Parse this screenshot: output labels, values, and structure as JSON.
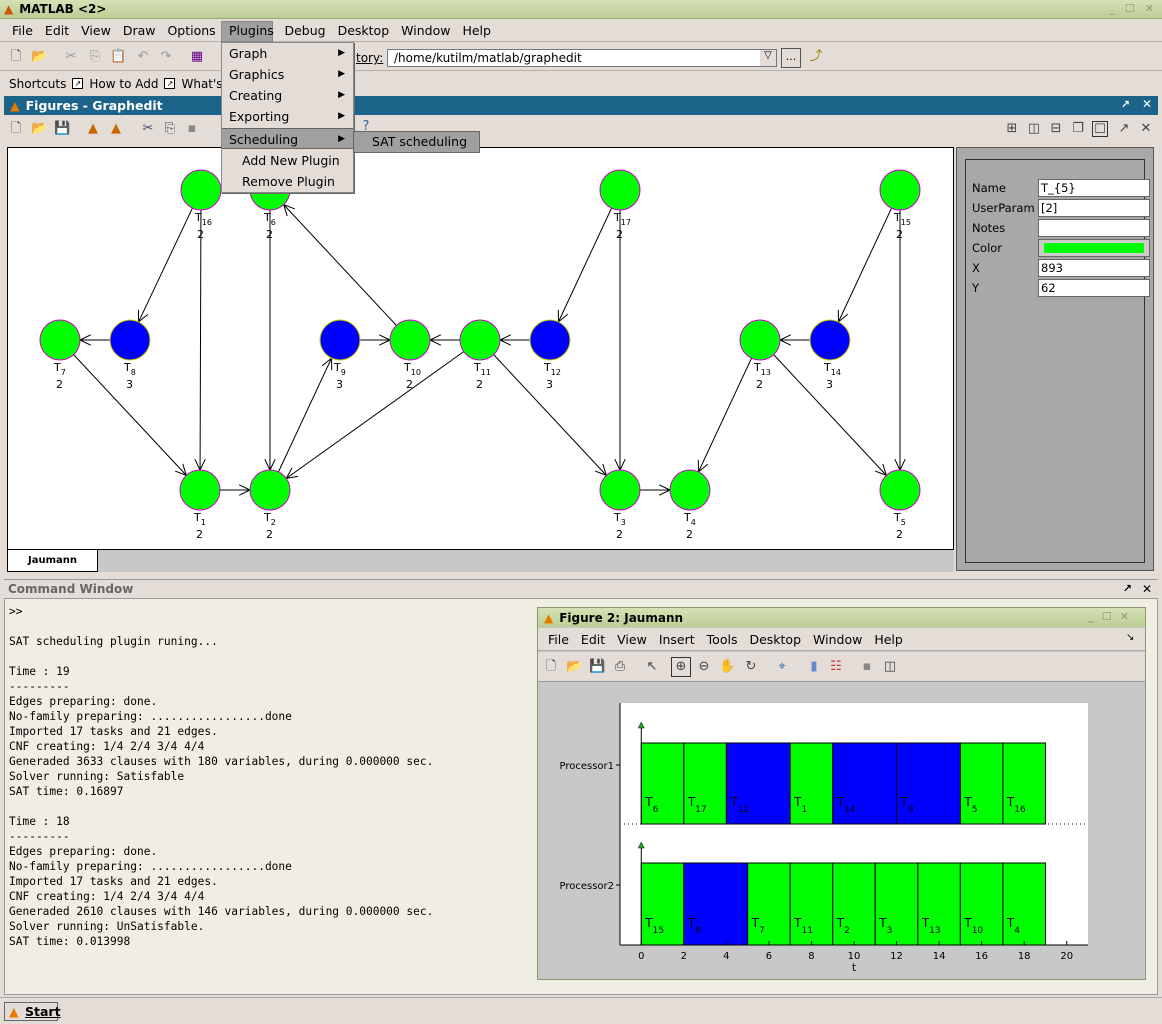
{
  "window": {
    "title": "MATLAB <2>"
  },
  "menubar": [
    "File",
    "Edit",
    "View",
    "Draw",
    "Options",
    "Plugins",
    "Debug",
    "Desktop",
    "Window",
    "Help"
  ],
  "menubar_active": "Plugins",
  "toolbar": {
    "current_dir_label": "Current Directory:",
    "current_dir_visible": "tory:",
    "current_dir_value": "/home/kutilm/matlab/graphedit",
    "browse_label": "..."
  },
  "shortcuts": {
    "label": "Shortcuts",
    "items": [
      "How to Add",
      "What's New"
    ]
  },
  "figures_panel": {
    "title": "Figures - Graphedit",
    "tab": "Jaumann"
  },
  "plugins_menu": {
    "items": [
      {
        "label": "Graph",
        "submenu": true
      },
      {
        "label": "Graphics",
        "submenu": true
      },
      {
        "label": "Creating",
        "submenu": true
      },
      {
        "label": "Exporting",
        "submenu": true
      },
      {
        "label": "Scheduling",
        "submenu": true,
        "selected": true
      },
      {
        "label": "Add New Plugin",
        "submenu": false
      },
      {
        "label": "Remove Plugin",
        "submenu": false
      }
    ],
    "scheduling_submenu": [
      "SAT scheduling"
    ]
  },
  "properties": {
    "name_label": "Name",
    "name": "T_{5}",
    "userparam_label": "UserParam",
    "userparam": "[2]",
    "notes_label": "Notes",
    "notes": "",
    "color_label": "Color",
    "color": "#00ff00",
    "x_label": "X",
    "x": "893",
    "y_label": "Y",
    "y": "62"
  },
  "graph": {
    "colors": {
      "green": "#00ff00",
      "blue": "#0000ff"
    },
    "nodes": [
      {
        "id": "T16",
        "label": "T",
        "sub": "16",
        "param": "2",
        "color": "green"
      },
      {
        "id": "T6",
        "label": "T",
        "sub": "6",
        "param": "2",
        "color": "green"
      },
      {
        "id": "T17",
        "label": "T",
        "sub": "17",
        "param": "2",
        "color": "green"
      },
      {
        "id": "T15",
        "label": "T",
        "sub": "15",
        "param": "2",
        "color": "green"
      },
      {
        "id": "T7",
        "label": "T",
        "sub": "7",
        "param": "2",
        "color": "green"
      },
      {
        "id": "T8",
        "label": "T",
        "sub": "8",
        "param": "3",
        "color": "blue"
      },
      {
        "id": "T9",
        "label": "T",
        "sub": "9",
        "param": "3",
        "color": "blue"
      },
      {
        "id": "T10",
        "label": "T",
        "sub": "10",
        "param": "2",
        "color": "green"
      },
      {
        "id": "T11",
        "label": "T",
        "sub": "11",
        "param": "2",
        "color": "green"
      },
      {
        "id": "T12",
        "label": "T",
        "sub": "12",
        "param": "3",
        "color": "blue"
      },
      {
        "id": "T13",
        "label": "T",
        "sub": "13",
        "param": "2",
        "color": "green"
      },
      {
        "id": "T14",
        "label": "T",
        "sub": "14",
        "param": "3",
        "color": "blue"
      },
      {
        "id": "T1",
        "label": "T",
        "sub": "1",
        "param": "2",
        "color": "green"
      },
      {
        "id": "T2",
        "label": "T",
        "sub": "2",
        "param": "2",
        "color": "green"
      },
      {
        "id": "T3",
        "label": "T",
        "sub": "3",
        "param": "2",
        "color": "green"
      },
      {
        "id": "T4",
        "label": "T",
        "sub": "4",
        "param": "2",
        "color": "green"
      },
      {
        "id": "T5",
        "label": "T",
        "sub": "5",
        "param": "2",
        "color": "green"
      }
    ],
    "edges": [
      [
        "T16",
        "T8"
      ],
      [
        "T16",
        "T1"
      ],
      [
        "T6",
        "T2"
      ],
      [
        "T10",
        "T6"
      ],
      [
        "T8",
        "T7"
      ],
      [
        "T7",
        "T1"
      ],
      [
        "T9",
        "T10"
      ],
      [
        "T11",
        "T10"
      ],
      [
        "T2",
        "T9"
      ],
      [
        "T11",
        "T2"
      ],
      [
        "T12",
        "T11"
      ],
      [
        "T17",
        "T12"
      ],
      [
        "T17",
        "T3"
      ],
      [
        "T11",
        "T3"
      ],
      [
        "T1",
        "T2"
      ],
      [
        "T3",
        "T4"
      ],
      [
        "T15",
        "T14"
      ],
      [
        "T14",
        "T13"
      ],
      [
        "T13",
        "T4"
      ],
      [
        "T13",
        "T5"
      ],
      [
        "T15",
        "T5"
      ]
    ]
  },
  "command_window": {
    "title": "Command Window",
    "lines": [
      ">>",
      "",
      "SAT scheduling plugin runing...",
      "",
      "Time : 19",
      "---------",
      "Edges preparing: done.",
      "No-family preparing: .................done",
      "Imported 17 tasks and 21 edges.",
      "CNF creating: 1/4 2/4 3/4 4/4",
      "Generaded 3633 clauses with 180 variables, during 0.000000 sec.",
      "Solver running: Satisfable",
      "SAT time: 0.16897",
      "",
      "Time : 18",
      "---------",
      "Edges preparing: done.",
      "No-family preparing: .................done",
      "Imported 17 tasks and 21 edges.",
      "CNF creating: 1/4 2/4 3/4 4/4",
      "Generaded 2610 clauses with 146 variables, during 0.000000 sec.",
      "Solver running: UnSatisfable.",
      "SAT time: 0.013998",
      "",
      "",
      "",
      ">>"
    ]
  },
  "figure2": {
    "title": "Figure 2: Jaumann",
    "menu": [
      "File",
      "Edit",
      "View",
      "Insert",
      "Tools",
      "Desktop",
      "Window",
      "Help"
    ]
  },
  "chart_data": {
    "type": "gantt",
    "title": "",
    "xlabel": "t",
    "ylabel": "",
    "xlim": [
      -1,
      21
    ],
    "xticks": [
      0,
      2,
      4,
      6,
      8,
      10,
      12,
      14,
      16,
      18,
      20
    ],
    "rows": [
      {
        "name": "Processor1",
        "tasks": [
          {
            "label": "T",
            "sub": "6",
            "start": 0,
            "end": 2,
            "color": "#00ff00"
          },
          {
            "label": "T",
            "sub": "17",
            "start": 2,
            "end": 4,
            "color": "#00ff00"
          },
          {
            "label": "T",
            "sub": "12",
            "start": 4,
            "end": 7,
            "color": "#0000ff"
          },
          {
            "label": "T",
            "sub": "1",
            "start": 7,
            "end": 9,
            "color": "#00ff00"
          },
          {
            "label": "T",
            "sub": "14",
            "start": 9,
            "end": 12,
            "color": "#0000ff"
          },
          {
            "label": "T",
            "sub": "9",
            "start": 12,
            "end": 15,
            "color": "#0000ff"
          },
          {
            "label": "T",
            "sub": "5",
            "start": 15,
            "end": 17,
            "color": "#00ff00"
          },
          {
            "label": "T",
            "sub": "16",
            "start": 17,
            "end": 19,
            "color": "#00ff00"
          }
        ]
      },
      {
        "name": "Processor2",
        "tasks": [
          {
            "label": "T",
            "sub": "15",
            "start": 0,
            "end": 2,
            "color": "#00ff00"
          },
          {
            "label": "T",
            "sub": "8",
            "start": 2,
            "end": 5,
            "color": "#0000ff"
          },
          {
            "label": "T",
            "sub": "7",
            "start": 5,
            "end": 7,
            "color": "#00ff00"
          },
          {
            "label": "T",
            "sub": "11",
            "start": 7,
            "end": 9,
            "color": "#00ff00"
          },
          {
            "label": "T",
            "sub": "2",
            "start": 9,
            "end": 11,
            "color": "#00ff00"
          },
          {
            "label": "T",
            "sub": "3",
            "start": 11,
            "end": 13,
            "color": "#00ff00"
          },
          {
            "label": "T",
            "sub": "13",
            "start": 13,
            "end": 15,
            "color": "#00ff00"
          },
          {
            "label": "T",
            "sub": "10",
            "start": 15,
            "end": 17,
            "color": "#00ff00"
          },
          {
            "label": "T",
            "sub": "4",
            "start": 17,
            "end": 19,
            "color": "#00ff00"
          }
        ]
      }
    ]
  },
  "startbar": {
    "start_label": "Start"
  }
}
